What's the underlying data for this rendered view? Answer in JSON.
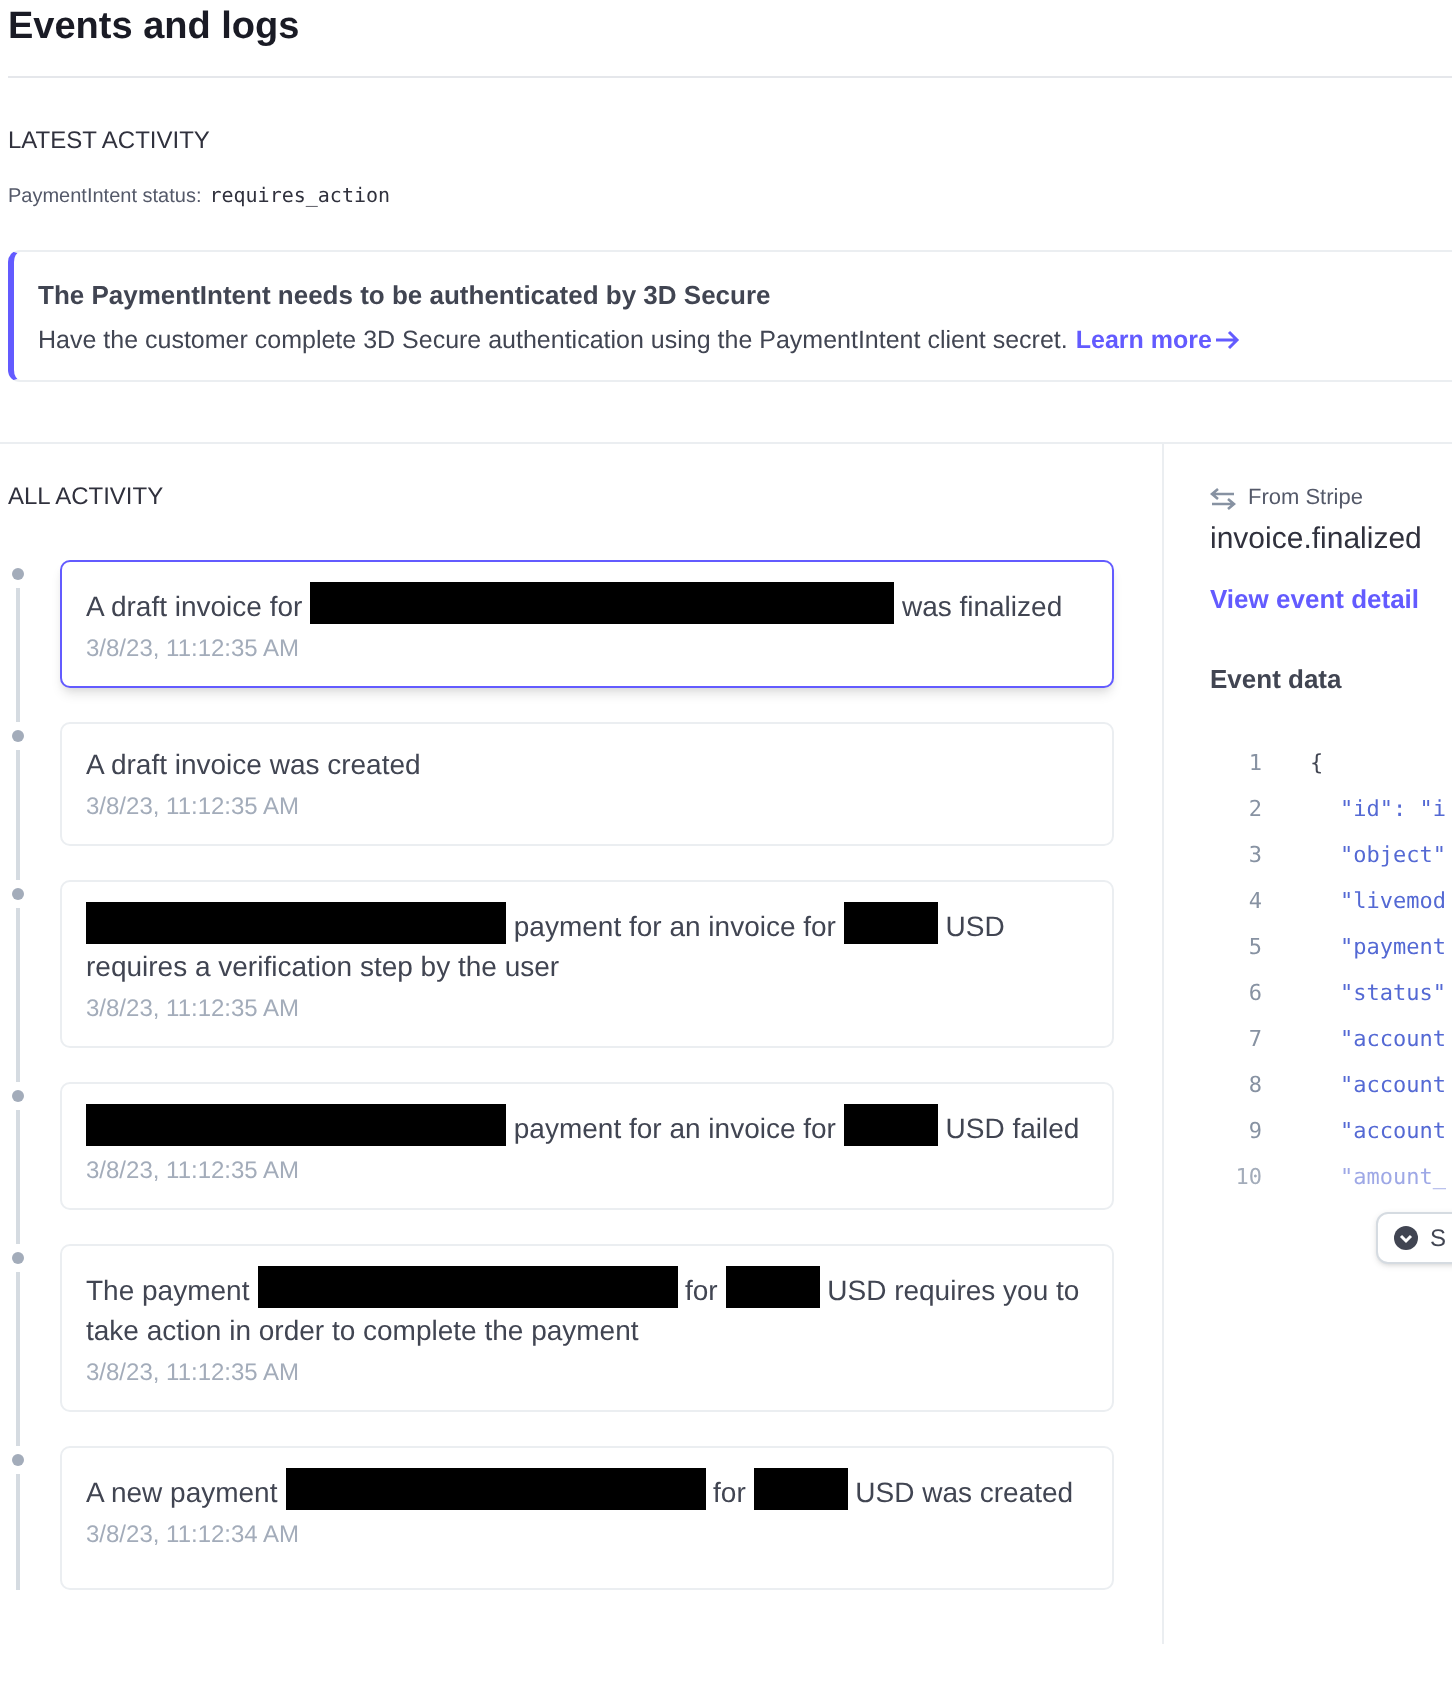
{
  "header": {
    "title": "Events and logs"
  },
  "latest_activity": {
    "heading": "LATEST ACTIVITY",
    "status_label": "PaymentIntent status:",
    "status_value": "requires_action"
  },
  "alert": {
    "title": "The PaymentIntent needs to be authenticated by 3D Secure",
    "message": "Have the customer complete 3D Secure authentication using the PaymentIntent client secret.",
    "link": "Learn more"
  },
  "all_activity": {
    "heading": "ALL ACTIVITY",
    "events": [
      {
        "selected": true,
        "time": "3/8/23, 11:12:35 AM",
        "segments": [
          {
            "kind": "text",
            "text": "A draft invoice for"
          },
          {
            "kind": "redacted_wide"
          },
          {
            "kind": "text",
            "text": "was finalized"
          }
        ]
      },
      {
        "selected": false,
        "time": "3/8/23, 11:12:35 AM",
        "segments": [
          {
            "kind": "text",
            "text": "A draft invoice was created"
          }
        ]
      },
      {
        "selected": false,
        "time": "3/8/23, 11:12:35 AM",
        "segments": [
          {
            "kind": "redacted"
          },
          {
            "kind": "text",
            "text": "payment for an invoice for"
          },
          {
            "kind": "redacted_small"
          },
          {
            "kind": "text",
            "text": "USD requires a verification step by the user"
          }
        ]
      },
      {
        "selected": false,
        "time": "3/8/23, 11:12:35 AM",
        "segments": [
          {
            "kind": "redacted"
          },
          {
            "kind": "text",
            "text": "payment for an invoice for"
          },
          {
            "kind": "redacted_small"
          },
          {
            "kind": "text",
            "text": "USD failed"
          }
        ]
      },
      {
        "selected": false,
        "time": "3/8/23, 11:12:35 AM",
        "segments": [
          {
            "kind": "text",
            "text": "The payment"
          },
          {
            "kind": "redacted"
          },
          {
            "kind": "text",
            "text": "for"
          },
          {
            "kind": "redacted_small"
          },
          {
            "kind": "text",
            "text": "USD requires you to take action in order to complete the payment"
          }
        ]
      },
      {
        "selected": false,
        "time": "3/8/23, 11:12:34 AM",
        "segments": [
          {
            "kind": "text",
            "text": "A new payment"
          },
          {
            "kind": "redacted"
          },
          {
            "kind": "text",
            "text": "for"
          },
          {
            "kind": "redacted_small"
          },
          {
            "kind": "text",
            "text": "USD was created"
          }
        ]
      }
    ]
  },
  "detail": {
    "source": "From Stripe",
    "event_type": "invoice.finalized",
    "link": "View event detail",
    "data_heading": "Event data",
    "code_lines": [
      {
        "number": "1",
        "text": "{",
        "faded": false
      },
      {
        "number": "2",
        "text": "\"id\": \"i",
        "faded": false
      },
      {
        "number": "3",
        "text": "\"object\"",
        "faded": false
      },
      {
        "number": "4",
        "text": "\"livemod",
        "faded": false
      },
      {
        "number": "5",
        "text": "\"payment",
        "faded": false
      },
      {
        "number": "6",
        "text": "\"status\"",
        "faded": false
      },
      {
        "number": "7",
        "text": "\"account",
        "faded": false
      },
      {
        "number": "8",
        "text": "\"account",
        "faded": false
      },
      {
        "number": "9",
        "text": "\"account",
        "faded": false
      },
      {
        "number": "10",
        "text": "\"amount_",
        "faded": true
      }
    ],
    "expand_button": "S"
  }
}
